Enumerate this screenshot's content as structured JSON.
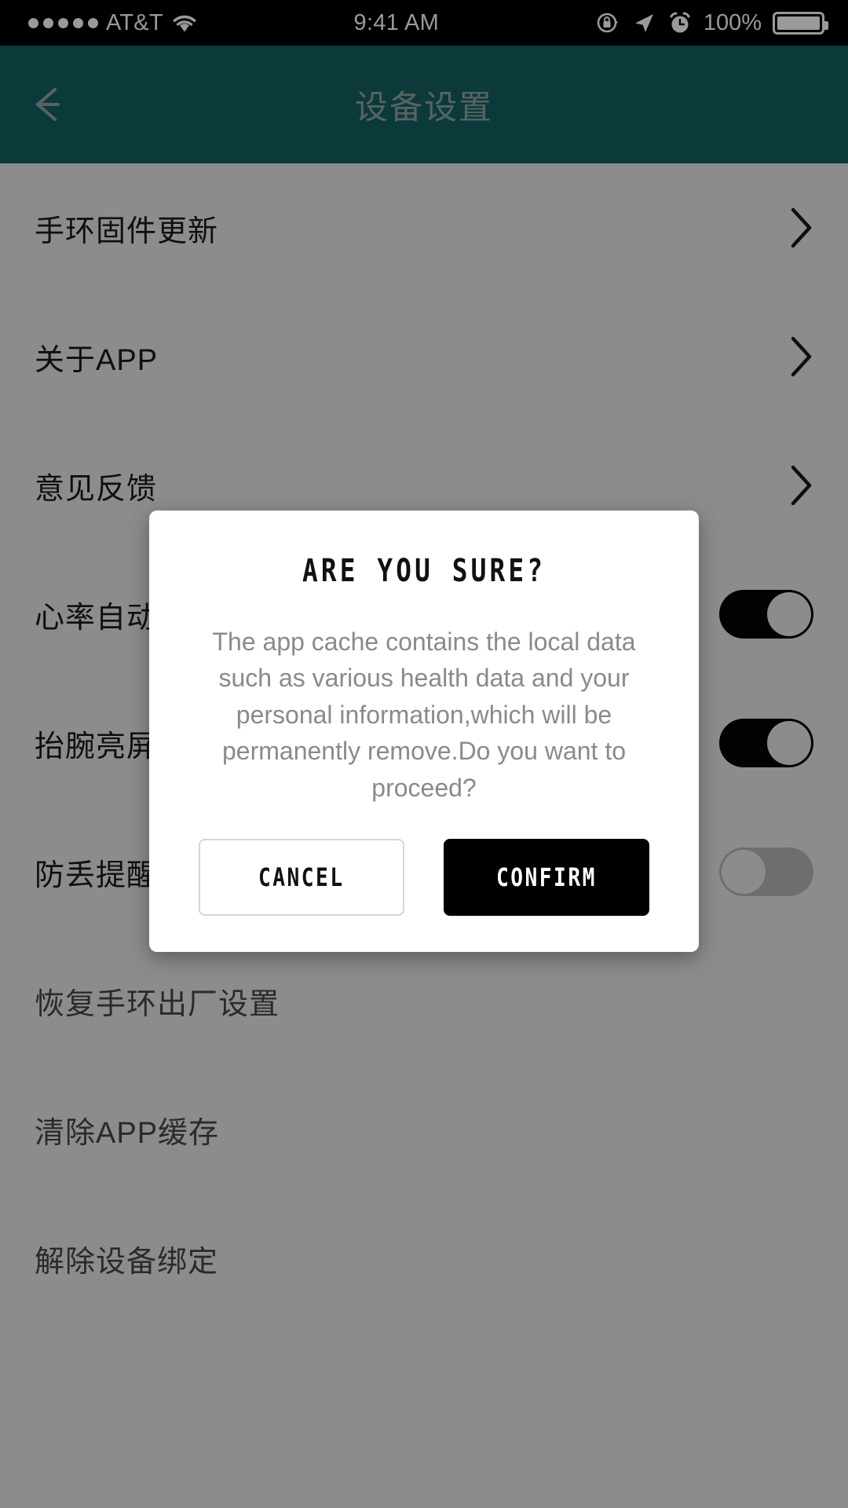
{
  "statusbar": {
    "signal_dots": 5,
    "carrier": "AT&T",
    "wifi_icon": "wifi-icon",
    "time": "9:41 AM",
    "rotation_lock_icon": "rotation-lock-icon",
    "location_icon": "location-arrow-icon",
    "alarm_icon": "alarm-clock-icon",
    "battery_percent": "100%",
    "battery_icon": "battery-full-icon",
    "bg_color": "#000000",
    "fg_color": "#9a9a9a"
  },
  "appbar": {
    "back_icon": "back-arrow-icon",
    "title": "设备设置",
    "bg_color": "#176b6b",
    "fg_color": "#9fb5b5"
  },
  "settings": {
    "rows": [
      {
        "label": "手环固件更新",
        "control": "chevron",
        "muted": false
      },
      {
        "label": "关于APP",
        "control": "chevron",
        "muted": false
      },
      {
        "label": "意见反馈",
        "control": "chevron",
        "muted": false
      },
      {
        "label": "心率自动监测",
        "control": "switch",
        "state": "on",
        "muted": false
      },
      {
        "label": "抬腕亮屏",
        "control": "switch",
        "state": "on",
        "muted": false
      },
      {
        "label": "防丢提醒",
        "control": "switch",
        "state": "off",
        "muted": false
      },
      {
        "label": "恢复手环出厂设置",
        "control": "none",
        "muted": true
      },
      {
        "label": "清除APP缓存",
        "control": "none",
        "muted": true
      },
      {
        "label": "解除设备绑定",
        "control": "none",
        "muted": true
      }
    ]
  },
  "dialog": {
    "title": "ARE YOU SURE?",
    "body": "The app cache contains the local data such as various health data and your personal information,which will be permanently remove.Do you want to proceed?",
    "cancel_label": "CANCEL",
    "confirm_label": "CONFIRM",
    "confirm_bg": "#000000",
    "cancel_bg": "#ffffff"
  }
}
